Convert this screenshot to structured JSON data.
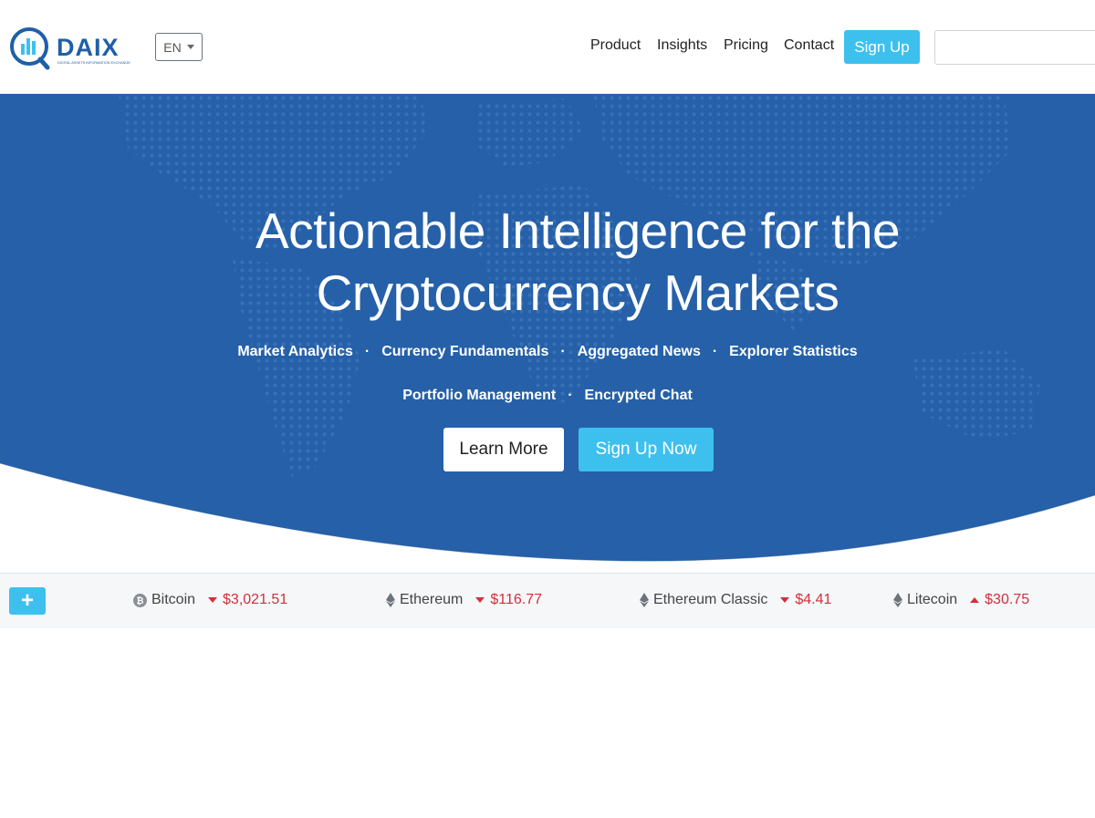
{
  "header": {
    "logo_text": "DAIX",
    "logo_tagline": "DIGITAL ASSETS INFORMATION EXCHANGE",
    "language": "EN",
    "nav": [
      "Product",
      "Insights",
      "Pricing",
      "Contact"
    ],
    "signup_label": "Sign Up",
    "search_placeholder": ""
  },
  "hero": {
    "title": "Actionable Intelligence for the Cryptocurrency Markets",
    "features_row1": [
      "Market Analytics",
      "Currency Fundamentals",
      "Aggregated News",
      "Explorer Statistics"
    ],
    "features_row2": [
      "Portfolio Management",
      "Encrypted Chat"
    ],
    "separator": "·",
    "learn_more_label": "Learn More",
    "signup_now_label": "Sign Up Now"
  },
  "ticker": {
    "add_label": "+",
    "coins": [
      {
        "name": "Bitcoin",
        "price": "$3,021.51",
        "direction": "down",
        "icon": "bitcoin-icon"
      },
      {
        "name": "Ethereum",
        "price": "$116.77",
        "direction": "down",
        "icon": "ethereum-icon"
      },
      {
        "name": "Ethereum Classic",
        "price": "$4.41",
        "direction": "down",
        "icon": "ethereum-icon"
      },
      {
        "name": "Litecoin",
        "price": "$30.75",
        "direction": "up",
        "icon": "litecoin-icon"
      }
    ]
  },
  "colors": {
    "hero_blue": "#2560a8",
    "accent": "#3ec0ee",
    "price_red": "#d32f3a",
    "logo_blue": "#1f5fa8"
  }
}
